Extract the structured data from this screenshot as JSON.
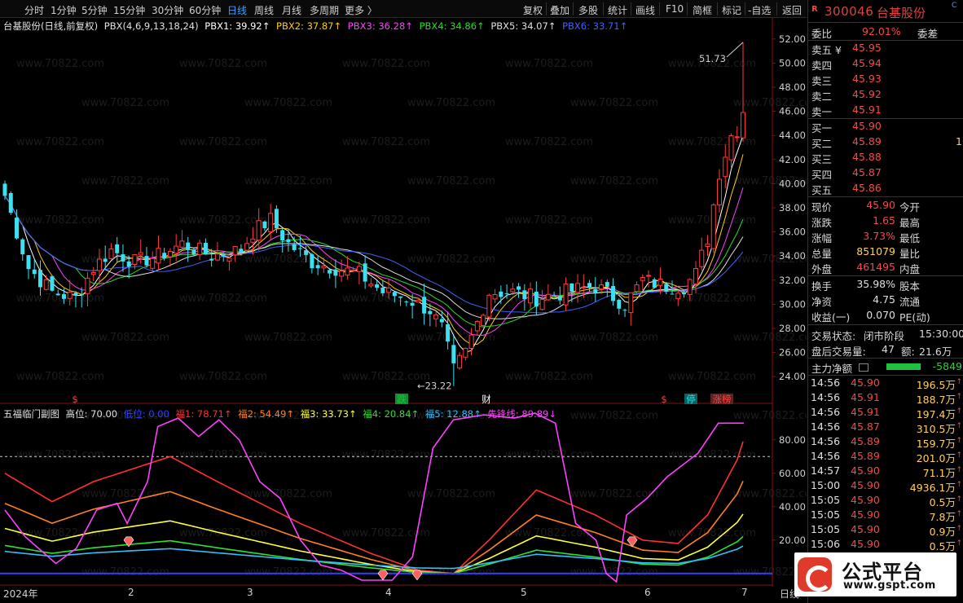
{
  "toolbar": {
    "periods": [
      "分时",
      "1分钟",
      "5分钟",
      "15分钟",
      "30分钟",
      "60分钟",
      "日线",
      "周线",
      "月线",
      "多周期",
      "更多 〉"
    ],
    "active_period": "日线",
    "tools": [
      "复权",
      "叠加",
      "多股",
      "统计",
      "画线",
      "F10",
      "简框",
      "标记",
      "-自选",
      "返回"
    ]
  },
  "main_chart": {
    "title": "台基股份(日线,前复权)",
    "indicator": "PBX(4,6,9,13,18,24)",
    "params": [
      {
        "label": "PBX1: 39.92↑",
        "color": "#ffffff"
      },
      {
        "label": "PBX2: 37.87↑",
        "color": "#ffd000"
      },
      {
        "label": "PBX3: 36.28↑",
        "color": "#ff40ff"
      },
      {
        "label": "PBX4: 34.86↑",
        "color": "#20e020"
      },
      {
        "label": "PBX5: 34.07↑",
        "color": "#e0e0e0"
      },
      {
        "label": "PBX6: 33.71↑",
        "color": "#4060ff"
      }
    ],
    "price_axis": [
      "52.00",
      "50.00",
      "48.00",
      "46.00",
      "44.00",
      "42.00",
      "40.00",
      "38.00",
      "36.00",
      "34.00",
      "32.00",
      "30.00",
      "28.00",
      "26.00",
      "24.00"
    ],
    "price_min": 23.2,
    "price_max": 52.8,
    "high_label": "51.73",
    "low_label": "←23.22",
    "watermark": "www.70822.com",
    "markers": [
      "$",
      "跌",
      "财",
      "$",
      "停",
      "涨榜"
    ]
  },
  "sub_chart": {
    "title": "五福临门副图",
    "params": [
      {
        "label": "高位: 70.00",
        "color": "#e0e0e0"
      },
      {
        "label": "低位: 0.00",
        "color": "#3040ff"
      },
      {
        "label": "福1: 78.71↑",
        "color": "#ff3030"
      },
      {
        "label": "福2: 54.49↑",
        "color": "#ff8020"
      },
      {
        "label": "福3: 33.73↑",
        "color": "#ffff40"
      },
      {
        "label": "福4: 20.84↑",
        "color": "#30e030"
      },
      {
        "label": "福5: 12.88↑",
        "color": "#30c0ff"
      },
      {
        "label": "先锋线: 89.89↓",
        "color": "#ff40ff"
      }
    ],
    "axis": [
      "80.00",
      "60.00",
      "40.00",
      "20.00"
    ]
  },
  "x_axis": [
    "2024年",
    "2",
    "3",
    "4",
    "5",
    "6",
    "7",
    "日线"
  ],
  "quote": {
    "badge": "R",
    "code": "300046",
    "name": "台基股份",
    "c_mark": "C",
    "weibi_label": "委比",
    "weibi": "92.01%",
    "weicha_label": "委差",
    "asks": [
      {
        "l": "卖五 ¥",
        "p": "45.95"
      },
      {
        "l": "卖四",
        "p": "45.94"
      },
      {
        "l": "卖三",
        "p": "45.93"
      },
      {
        "l": "卖二",
        "p": "45.92"
      },
      {
        "l": "卖一",
        "p": "45.91"
      }
    ],
    "bids": [
      {
        "l": "买一",
        "p": "45.90",
        "v": ""
      },
      {
        "l": "买二",
        "p": "45.89",
        "v": "1"
      },
      {
        "l": "买三",
        "p": "45.88",
        "v": ""
      },
      {
        "l": "买四",
        "p": "45.87",
        "v": ""
      },
      {
        "l": "买五",
        "p": "45.86",
        "v": ""
      }
    ],
    "stats": [
      {
        "l": "现价",
        "v": "45.90",
        "c": "red",
        "r": "今开"
      },
      {
        "l": "涨跌",
        "v": "1.65",
        "c": "red",
        "r": "最高"
      },
      {
        "l": "涨幅",
        "v": "3.73%",
        "c": "red",
        "r": "最低"
      },
      {
        "l": "总量",
        "v": "851079",
        "c": "yel",
        "r": "量比"
      },
      {
        "l": "外盘",
        "v": "461495",
        "c": "red",
        "r": "内盘"
      }
    ],
    "stats2": [
      {
        "l": "换手",
        "v": "35.98%",
        "r": "股本"
      },
      {
        "l": "净资",
        "v": "4.75",
        "r": "流通"
      },
      {
        "l": "收益(一)",
        "v": "0.070",
        "r": "PE(动)"
      }
    ],
    "status_label": "交易状态:",
    "status": "闭市阶段",
    "status_time": "15:30:00",
    "after_label": "盘后交易量:",
    "after_vol": "47",
    "after_amt_label": "额:",
    "after_amt": "21.6万",
    "flow_label": "主力净额",
    "flow_value": "-5849",
    "ticks": [
      {
        "t": "14:56",
        "p": "45.90",
        "q": "196.5万"
      },
      {
        "t": "14:56",
        "p": "45.91",
        "q": "188.7万"
      },
      {
        "t": "14:56",
        "p": "45.91",
        "q": "197.4万"
      },
      {
        "t": "14:56",
        "p": "45.87",
        "q": "310.5万"
      },
      {
        "t": "14:56",
        "p": "45.89",
        "q": "159.7万"
      },
      {
        "t": "14:56",
        "p": "45.89",
        "q": "201.0万"
      },
      {
        "t": "14:57",
        "p": "45.90",
        "q": "71.1万"
      },
      {
        "t": "15:00",
        "p": "45.90",
        "q": "4936.1万"
      },
      {
        "t": "15:05",
        "p": "45.90",
        "q": "0.5万"
      },
      {
        "t": "15:05",
        "p": "45.90",
        "q": "7.8万"
      },
      {
        "t": "15:05",
        "p": "45.90",
        "q": "0.9万"
      },
      {
        "t": "15:06",
        "p": "45.90",
        "q": "0.5万"
      }
    ]
  },
  "logo": {
    "name": "公式平台",
    "url": "www.gspt.com"
  }
}
